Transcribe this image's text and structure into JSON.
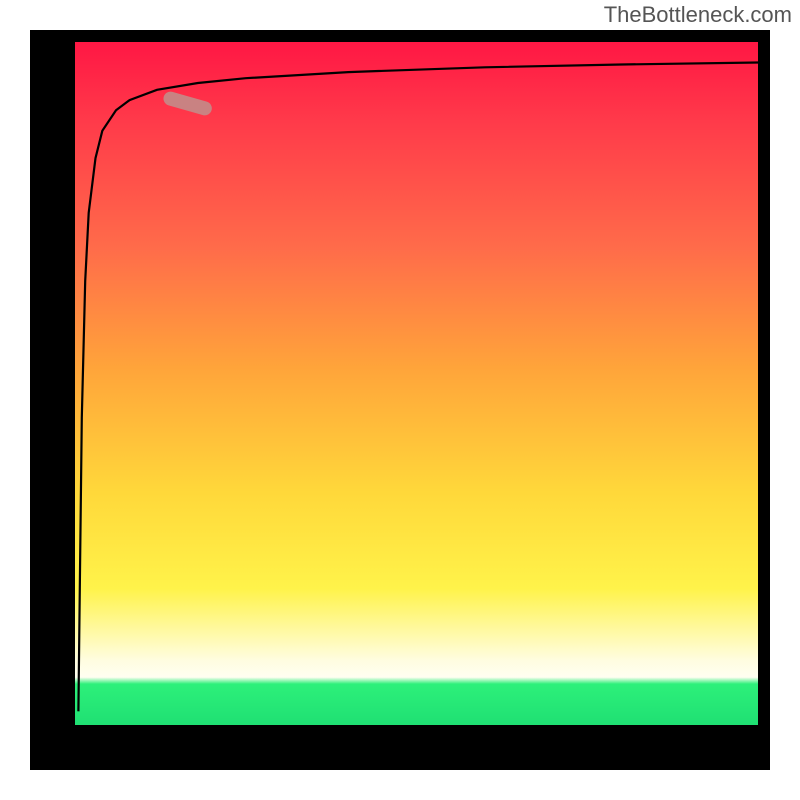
{
  "attribution": "TheBottleneck.com",
  "colors": {
    "gradient_top": "#ff1744",
    "gradient_mid1": "#ff6b4a",
    "gradient_mid2": "#ffd83a",
    "gradient_pale": "#fffde0",
    "gradient_bottom": "#1fe073",
    "curve": "#000000",
    "marker": "#c98282",
    "frame": "#000000"
  },
  "chart_data": {
    "type": "line",
    "title": "",
    "xlabel": "",
    "ylabel": "",
    "xlim": [
      0,
      100
    ],
    "ylim": [
      0,
      100
    ],
    "grid": false,
    "legend": false,
    "series": [
      {
        "name": "curve",
        "x": [
          0.5,
          0.7,
          1,
          1.5,
          2,
          3,
          4,
          6,
          8,
          12,
          18,
          25,
          40,
          60,
          80,
          100
        ],
        "y": [
          2,
          20,
          45,
          65,
          75,
          83,
          87,
          90,
          91.5,
          93,
          94,
          94.7,
          95.6,
          96.3,
          96.7,
          97
        ]
      }
    ],
    "marker": {
      "x_range": [
        13,
        20
      ],
      "y_range": [
        90,
        92
      ],
      "shape": "rounded-capsule"
    },
    "background_gradient": {
      "orientation": "vertical",
      "stops": [
        {
          "pos": 0.0,
          "color": "#ff1744"
        },
        {
          "pos": 0.3,
          "color": "#ff6b4a"
        },
        {
          "pos": 0.66,
          "color": "#ffd83a"
        },
        {
          "pos": 0.91,
          "color": "#fffde0"
        },
        {
          "pos": 0.94,
          "color": "#2df07a"
        },
        {
          "pos": 1.0,
          "color": "#1fe073"
        }
      ]
    }
  }
}
